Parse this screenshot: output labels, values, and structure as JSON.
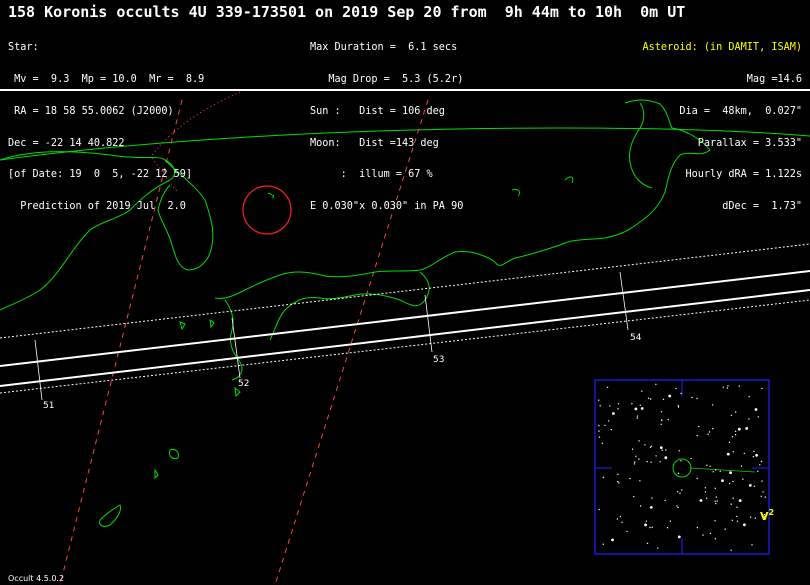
{
  "title": "158 Koronis occults 4U 339-173501 on 2019 Sep 20 from  9h 44m to 10h  0m UT",
  "star": {
    "lines": [
      "Star:",
      " Mv =  9.3  Mp = 10.0  Mr =  8.9",
      " RA = 18 58 55.0062 (J2000)",
      "Dec = -22 14 40.822",
      "[of Date: 19  0  5, -22 12 59]",
      "  Prediction of 2019 Jul  2.0"
    ]
  },
  "event": {
    "lines": [
      "Max Duration =  6.1 secs",
      "   Mag Drop =  5.3 (5.2r)",
      "Sun :   Dist = 106 deg",
      "Moon:   Dist =143 deg",
      "     :  illum = 67 %",
      "E 0.030\"x 0.030\" in PA 90"
    ]
  },
  "asteroid": {
    "heading": "Asteroid: (in DAMIT, ISAM)",
    "lines": [
      "Mag =14.6",
      "Dia =  48km,  0.027\"",
      "Parallax = 3.533\"",
      "Hourly dRA = 1.122s",
      "dDec =  1.73\""
    ]
  },
  "time_ticks": [
    "51",
    "52",
    "53",
    "54"
  ],
  "star_chart": {
    "label": "V",
    "superscript": "2"
  },
  "footer": "Occult 4.5.0.2",
  "colors": {
    "coastline": "#00dd00",
    "path_center": "#ffffff",
    "path_limits": "#ffffff",
    "sun_lines": "#ff4444",
    "moon_circle": "#ff2020",
    "chart_border": "#2222ff",
    "title_text": "#ffffff",
    "asteroid_text": "#ffff00"
  }
}
